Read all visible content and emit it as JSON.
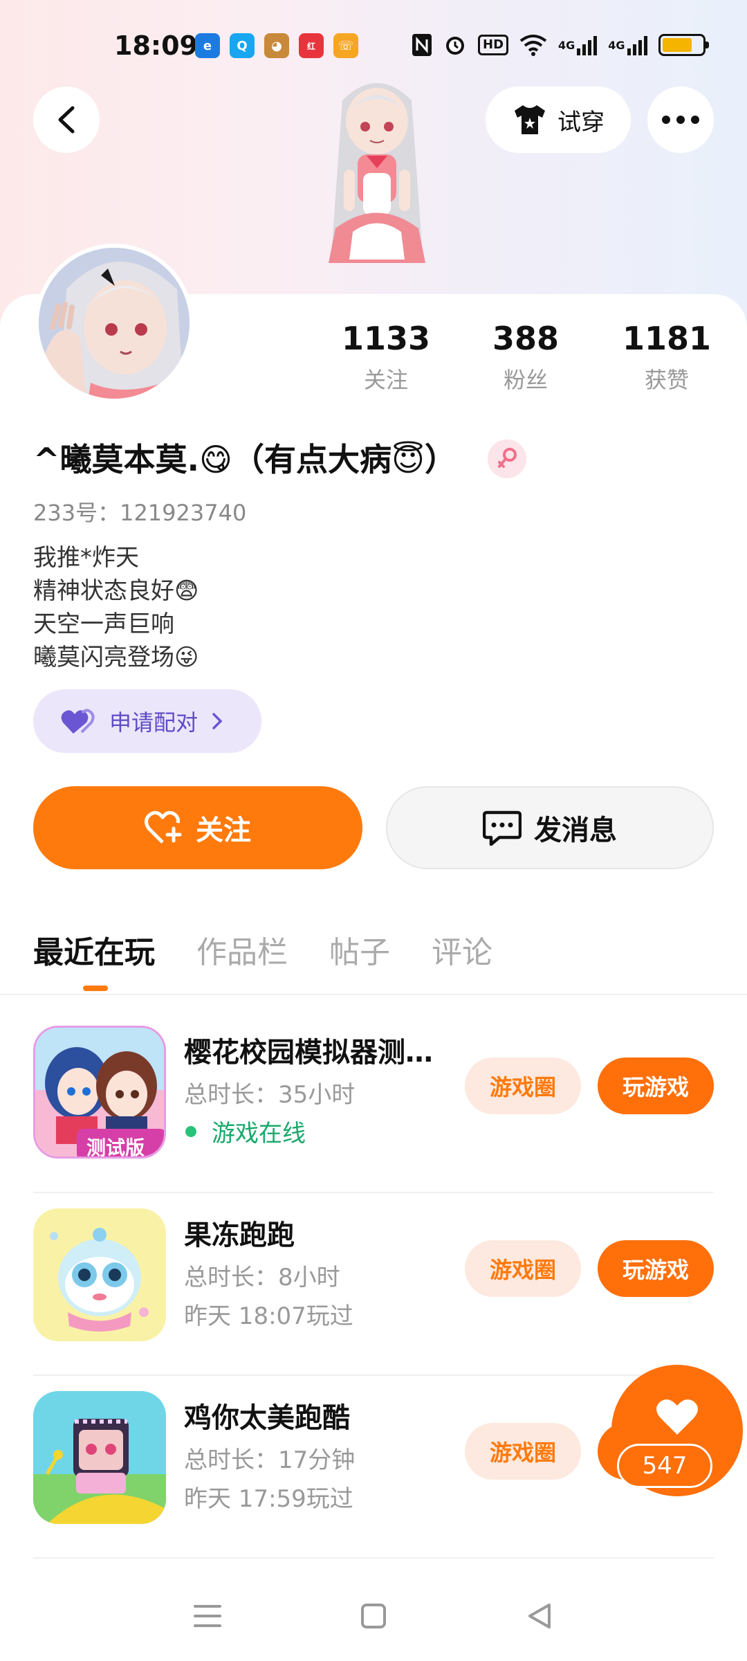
{
  "status_bar": {
    "time": "18:09",
    "notification_icons": [
      "edge-browser-icon",
      "qq-icon",
      "monkey-app-icon",
      "xiaohongshu-icon",
      "phone-app-icon"
    ],
    "hd_label": "HD",
    "signal_1": "4G",
    "signal_2": "4G",
    "battery_level": 0.75
  },
  "header": {
    "try_on_label": "试穿"
  },
  "profile": {
    "following_count": "1133",
    "following_label": "关注",
    "fans_count": "388",
    "fans_label": "粉丝",
    "likes_count": "1181",
    "likes_label": "获赞",
    "nickname": "^曦莫本莫.😋（有点大病😇）",
    "uid": "233号：121923740",
    "bio_lines": [
      "我推*炸天",
      "精神状态良好😨",
      "天空一声巨响",
      "曦莫闪亮登场😜"
    ],
    "pair_label": "申请配对"
  },
  "actions": {
    "follow_label": "关注",
    "message_label": "发消息"
  },
  "tabs": [
    {
      "label": "最近在玩",
      "active": true
    },
    {
      "label": "作品栏",
      "active": false
    },
    {
      "label": "帖子",
      "active": false
    },
    {
      "label": "评论",
      "active": false
    }
  ],
  "games": [
    {
      "name": "樱花校园模拟器测试版",
      "duration": "总时长：35小时",
      "status": "游戏在线",
      "online": true,
      "circle_label": "游戏圈",
      "play_label": "玩游戏",
      "icon_badge": "测试版"
    },
    {
      "name": "果冻跑跑",
      "duration": "总时长：8小时",
      "status": "昨天 18:07玩过",
      "online": false,
      "circle_label": "游戏圈",
      "play_label": "玩游戏"
    },
    {
      "name": "鸡你太美跑酷",
      "duration": "总时长：17分钟",
      "status": "昨天 17:59玩过",
      "online": false,
      "circle_label": "游戏圈",
      "play_label": "玩游戏"
    }
  ],
  "like_fab": {
    "count": "547"
  },
  "colors": {
    "accent": "#ff7a0d",
    "online": "#19a96b",
    "pair_bg": "#ece6fb",
    "pair_text": "#5e4cc4"
  }
}
